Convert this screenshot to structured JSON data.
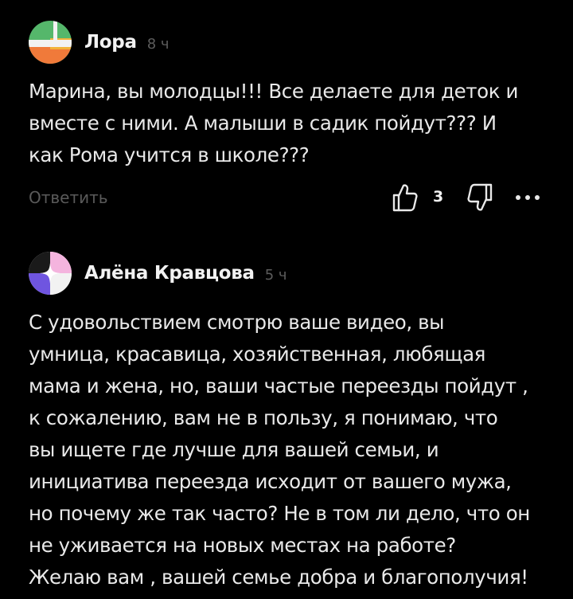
{
  "comments": [
    {
      "author": "Лора",
      "time": "8 ч",
      "text_lines": [
        "Марина, вы молодцы!!! Все делаете для деток и",
        "вместе с ними. А малыши в садик пойдут??? И",
        "как Рома учится в школе???"
      ],
      "reply_label": "Ответить",
      "likes": "3",
      "avatar_colors": [
        "#55b76b",
        "#f2f2f2",
        "#f2b33a",
        "#f07a3a"
      ]
    },
    {
      "author": "Алёна Кравцова",
      "time": "5 ч",
      "text_lines": [
        "С удовольствием смотрю ваше видео, вы",
        "умница, красавица, хозяйственная, любящая",
        "мама и жена, но, ваши частые переезды пойдут ,",
        "к сожалению, вам не в пользу, я понимаю, что",
        "вы ищете где лучше для вашей семьи, и",
        "инициатива переезда исходит от вашего мужа,",
        "но почему же так часто? Не в том ли дело, что он",
        "не уживается на новых местах на работе?",
        "Желаю вам , вашей семье добра и благополучия!"
      ],
      "avatar_colors": [
        "#f4b4de",
        "#f2f2f2",
        "#6f55e0",
        "#1a1a1a"
      ]
    }
  ],
  "icons": {
    "like": "thumbs-up-icon",
    "dislike": "thumbs-down-icon",
    "more": "more-dots-icon"
  }
}
